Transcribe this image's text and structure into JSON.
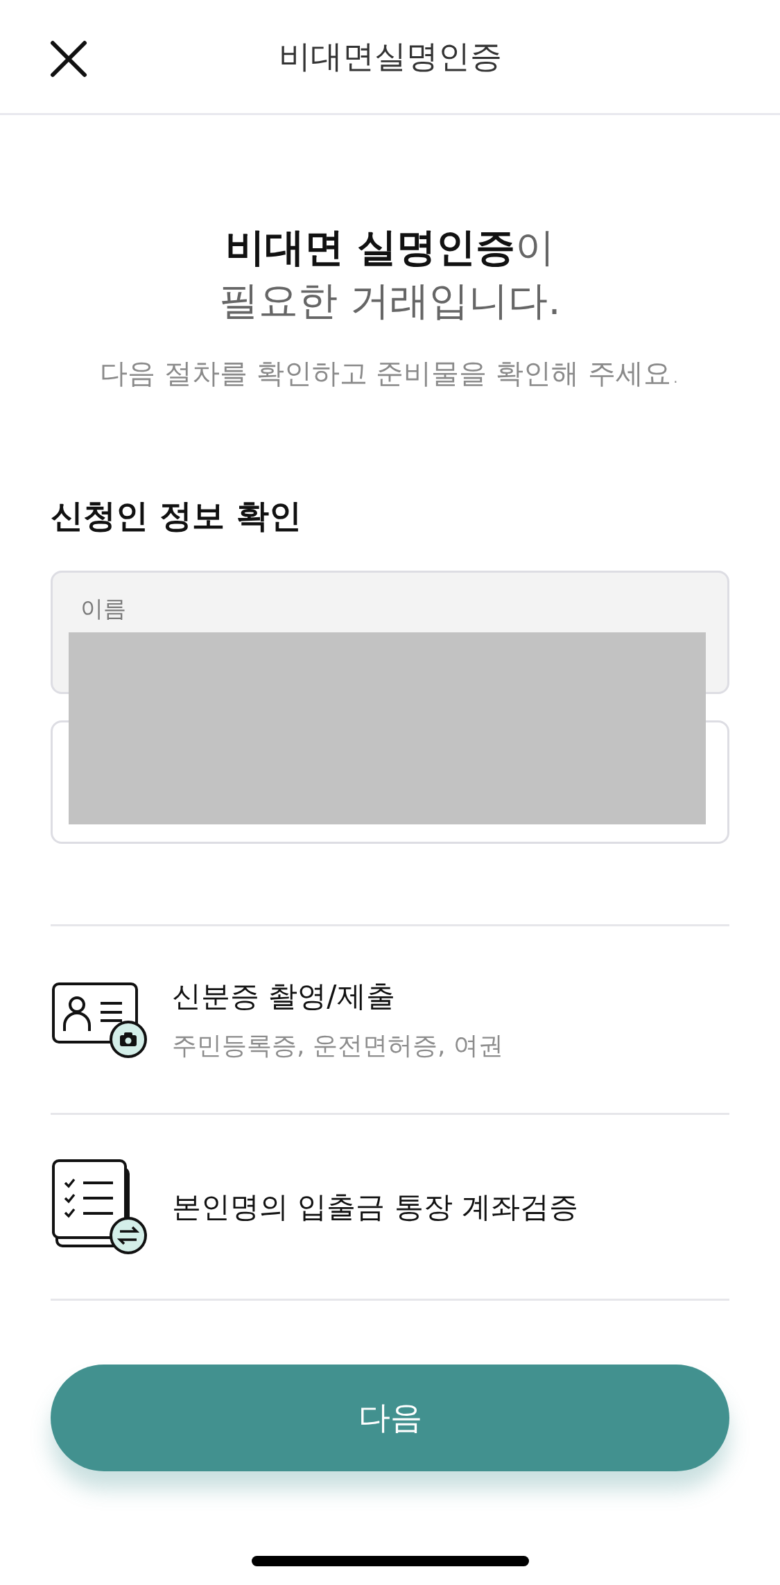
{
  "header": {
    "title": "비대면실명인증"
  },
  "intro": {
    "headline_lines": [
      "**비대면 실명인증**이",
      "필요한 거래입니다."
    ],
    "subtitle": "다음 절차를 확인하고 준비물을 확인해 주세요."
  },
  "applicant": {
    "title": "신청인 정보 확인",
    "fields": [
      {
        "label": "이름",
        "disabled": true
      },
      {
        "disabled": false
      }
    ]
  },
  "requirements": [
    {
      "kind": "id-card",
      "title": "신분증 촬영/제출",
      "subtitle": "주민등록증, 운전면허증, 여권"
    },
    {
      "kind": "account",
      "title": "본인명의 입출금 통장 계좌검증"
    }
  ],
  "next_button": {
    "label": "다음"
  }
}
